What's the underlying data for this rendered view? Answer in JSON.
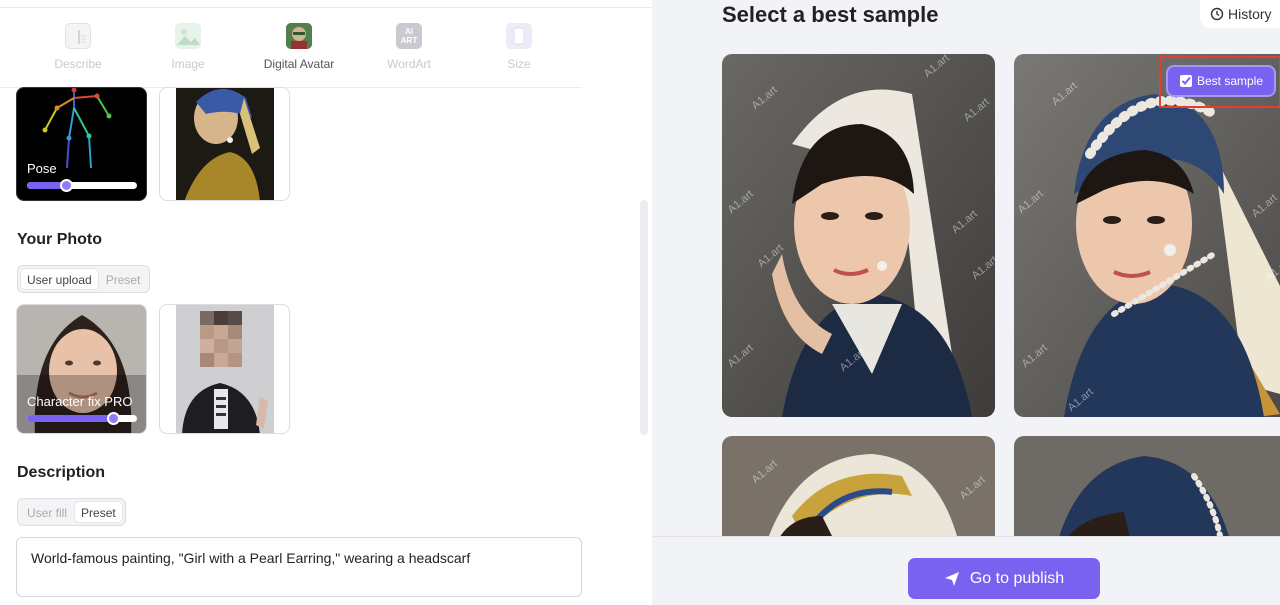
{
  "tabs": [
    {
      "label": "Describe",
      "icon": "describe-icon",
      "active": false
    },
    {
      "label": "Image",
      "icon": "image-icon",
      "active": false
    },
    {
      "label": "Digital Avatar",
      "icon": "avatar-icon",
      "active": true
    },
    {
      "label": "WordArt",
      "icon": "wordart-icon",
      "active": false
    },
    {
      "label": "Size",
      "icon": "size-icon",
      "active": false
    }
  ],
  "wordart_icon_text": "AI ART",
  "pose": {
    "label": "Pose",
    "level": 0.35
  },
  "your_photo": {
    "title": "Your Photo",
    "options": [
      "User upload",
      "Preset"
    ],
    "selected": "User upload",
    "character_fix": {
      "label": "Character fix PRO",
      "level": 0.78
    }
  },
  "description": {
    "title": "Description",
    "options": [
      "User fill",
      "Preset"
    ],
    "selected": "Preset",
    "text": "World-famous painting, \"Girl with a Pearl Earring,\" wearing a headscarf"
  },
  "right": {
    "title": "Select a best sample",
    "history_label": "History",
    "best_sample_label": "Best sample",
    "publish_label": "Go to publish",
    "watermark": "A1.art"
  },
  "colors": {
    "accent": "#7a62f0",
    "highlight": "#e0402c",
    "panel_bg": "#f2f3f7"
  }
}
